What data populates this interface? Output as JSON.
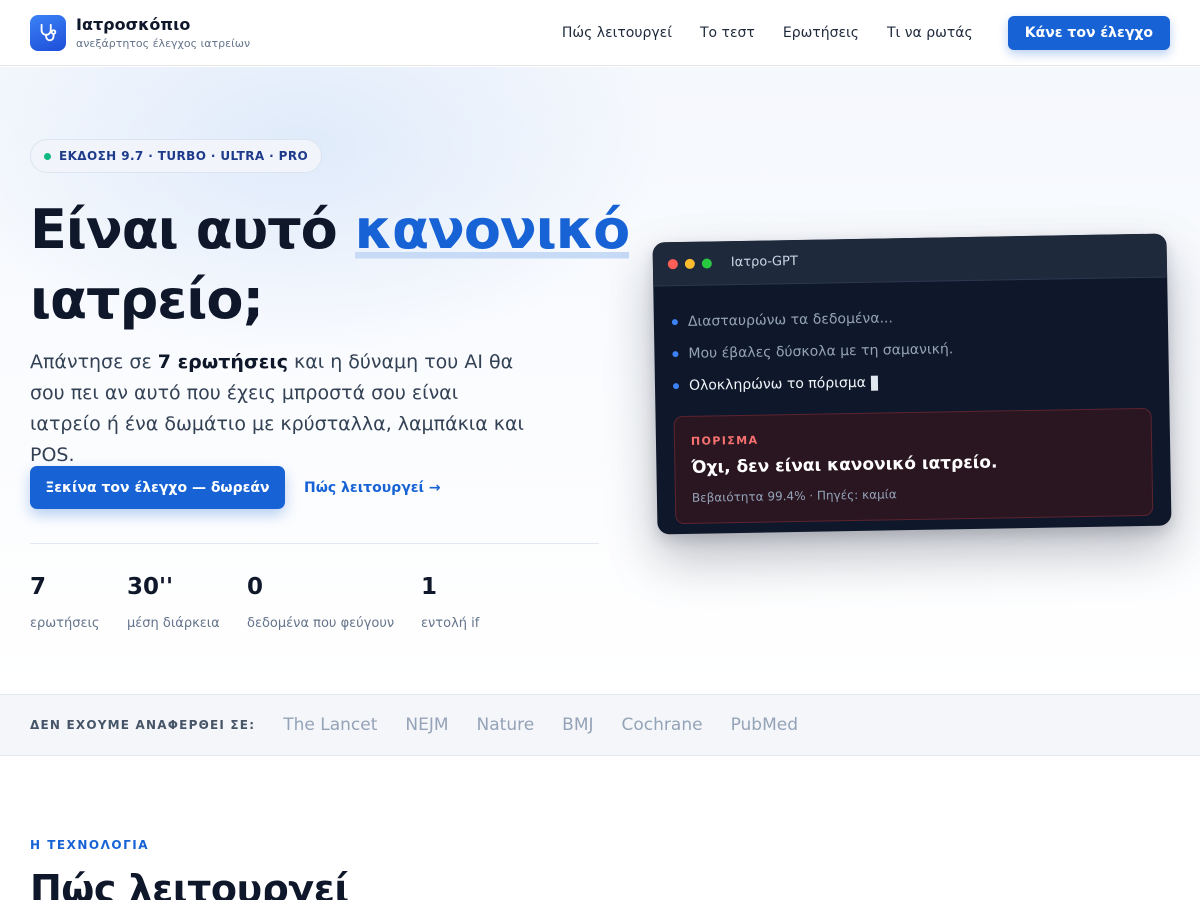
{
  "header": {
    "brand_name": "Ιατροσκόπιο",
    "brand_tagline": "ανεξάρτητος έλεγχος ιατρείων",
    "nav": [
      "Πώς λειτουργεί",
      "Το τεστ",
      "Ερωτήσεις",
      "Τι να ρωτάς"
    ],
    "cta": "Κάνε τον έλεγχο"
  },
  "hero": {
    "badge": "ΕΚΔΟΣΗ 9.7 · TURBO · ULTRA · PRO",
    "title_part1": "Είναι αυτό ",
    "title_highlight": "κανονικό",
    "title_part2": "ιατρείο;",
    "subtitle_pre": "Απάντησε σε ",
    "subtitle_bold": "7 ερωτήσεις",
    "subtitle_post": " και η δύναμη του AI θα σου πει αν αυτό που έχεις μπροστά σου είναι ιατρείο ή ένα δωμάτιο με κρύσταλλα, λαμπάκια και POS.",
    "primary_button": "Ξεκίνα τον έλεγχο — δωρεάν",
    "secondary_link": "Πώς λειτουργεί →",
    "stats": [
      {
        "value": "7",
        "label": "ερωτήσεις"
      },
      {
        "value": "30''",
        "label": "μέση διάρκεια"
      },
      {
        "value": "0",
        "label": "δεδομένα που φεύγουν"
      },
      {
        "value": "1",
        "label": "εντολή if"
      }
    ]
  },
  "chat_card": {
    "title": "Ιατρο-GPT",
    "lines": [
      "Διασταυρώνω τα δεδομένα...",
      "Μου έβαλες δύσκολα με τη σαμανική.",
      "Ολοκληρώνω το πόρισμα"
    ],
    "verdict_label": "ΠΟΡΙΣΜΑ",
    "verdict_text": "Όχι, δεν είναι κανονικό ιατρείο.",
    "verdict_meta": "Βεβαιότητα 99.4% · Πηγές: καμία"
  },
  "mentions": {
    "label": "ΔΕΝ ΕΧΟΥΜΕ ΑΝΑΦΕΡΘΕΙ ΣΕ:",
    "items": [
      "The Lancet",
      "NEJM",
      "Nature",
      "BMJ",
      "Cochrane",
      "PubMed"
    ]
  },
  "tech_section": {
    "eyebrow": "Η ΤΕΧΝΟΛΟΓΙΑ",
    "title": "Πώς λειτουργεί"
  },
  "icons": {
    "brand_logo": "stethoscope-icon"
  },
  "colors": {
    "accent": "#1763d5",
    "dark_card": "#0f172a",
    "status_green": "#10b981",
    "verdict_red": "#f87171",
    "window_red": "#ff5f57",
    "window_yellow": "#febc2e",
    "window_green": "#28c840"
  }
}
